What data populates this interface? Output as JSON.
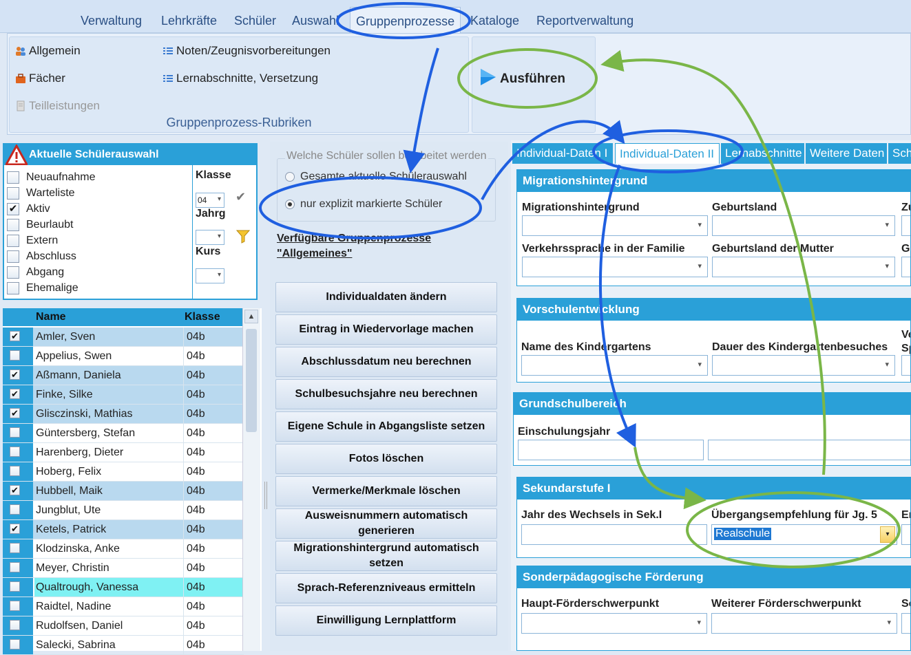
{
  "menu": {
    "items": [
      "Verwaltung",
      "Lehrkräfte",
      "Schüler",
      "Auswahl",
      "Gruppenprozesse",
      "Kataloge",
      "Reportverwaltung"
    ],
    "active_index": 4
  },
  "ribbon": {
    "allgemein": "Allgemein",
    "faecher": "Fächer",
    "teilleistungen": "Teilleistungen",
    "noten": "Noten/Zeugnisvorbereitungen",
    "lernabschnitte": "Lernabschnitte, Versetzung",
    "group_caption": "Gruppenprozess-Rubriken",
    "ausfuehren": "Ausführen"
  },
  "selection": {
    "title": "Aktuelle Schülerauswahl",
    "statuses": [
      {
        "label": "Neuaufnahme",
        "checked": false
      },
      {
        "label": "Warteliste",
        "checked": false
      },
      {
        "label": "Aktiv",
        "checked": true
      },
      {
        "label": "Beurlaubt",
        "checked": false
      },
      {
        "label": "Extern",
        "checked": false
      },
      {
        "label": "Abschluss",
        "checked": false
      },
      {
        "label": "Abgang",
        "checked": false
      },
      {
        "label": "Ehemalige",
        "checked": false
      }
    ],
    "klasse_label": "Klasse",
    "klasse_value": "04",
    "jahrg_label": "Jahrg",
    "kurs_label": "Kurs"
  },
  "students": {
    "col_name": "Name",
    "col_klasse": "Klasse",
    "rows": [
      {
        "name": "Amler, Sven",
        "klasse": "04b",
        "checked": true
      },
      {
        "name": "Appelius, Swen",
        "klasse": "04b",
        "checked": false
      },
      {
        "name": "Aßmann, Daniela",
        "klasse": "04b",
        "checked": true
      },
      {
        "name": "Finke, Silke",
        "klasse": "04b",
        "checked": true
      },
      {
        "name": "Glisczinski, Mathias",
        "klasse": "04b",
        "checked": true
      },
      {
        "name": "Güntersberg, Stefan",
        "klasse": "04b",
        "checked": false
      },
      {
        "name": "Harenberg, Dieter",
        "klasse": "04b",
        "checked": false
      },
      {
        "name": "Hoberg, Felix",
        "klasse": "04b",
        "checked": false
      },
      {
        "name": "Hubbell, Maik",
        "klasse": "04b",
        "checked": true
      },
      {
        "name": "Jungblut, Ute",
        "klasse": "04b",
        "checked": false
      },
      {
        "name": "Ketels, Patrick",
        "klasse": "04b",
        "checked": true
      },
      {
        "name": "Klodzinska, Anke",
        "klasse": "04b",
        "checked": false
      },
      {
        "name": "Meyer, Christin",
        "klasse": "04b",
        "checked": false
      },
      {
        "name": "Qualtrough, Vanessa",
        "klasse": "04b",
        "checked": false,
        "highlight": true
      },
      {
        "name": "Raidtel, Nadine",
        "klasse": "04b",
        "checked": false
      },
      {
        "name": "Rudolfsen, Daniel",
        "klasse": "04b",
        "checked": false
      },
      {
        "name": "Salecki, Sabrina",
        "klasse": "04b",
        "checked": false
      }
    ]
  },
  "middle": {
    "question": "Welche Schüler sollen bearbeitet werden",
    "opt_all": "Gesamte aktuelle Schülerauswahl",
    "opt_marked": "nur explizit markierte Schüler",
    "available_line1": "Verfügbare Gruppenprozesse",
    "available_line2": "\"Allgemeines\"",
    "processes": [
      "Individualdaten ändern",
      "Eintrag in Wiedervorlage machen",
      "Abschlussdatum neu berechnen",
      "Schulbesuchsjahre neu berechnen",
      "Eigene Schule in Abgangsliste setzen",
      "Fotos löschen",
      "Vermerke/Merkmale löschen",
      "Ausweisnummern automatisch generieren",
      "Migrationshintergrund automatisch setzen",
      "Sprach-Referenzniveaus ermitteln",
      "Einwilligung Lernplattform"
    ]
  },
  "tabs": [
    "Individual-Daten I",
    "Individual-Daten II",
    "Lernabschnitte",
    "Weitere Daten",
    "Sch"
  ],
  "sections": {
    "migration": {
      "title": "Migrationshintergrund",
      "f1": "Migrationshintergrund",
      "f2": "Geburtsland",
      "f3": "Zu",
      "f4": "Verkehrssprache in der Familie",
      "f5": "Geburtsland der Mutter",
      "f6": "Ge"
    },
    "vorschule": {
      "title": "Vorschulentwicklung",
      "f1": "Name des Kindergartens",
      "f2": "Dauer des Kindergartenbesuches",
      "f3a": "Ve",
      "f3b": "Sp"
    },
    "grundschule": {
      "title": "Grundschulbereich",
      "f1": "Einschulungsjahr"
    },
    "sek1": {
      "title": "Sekundarstufe I",
      "f1": "Jahr des Wechsels in Sek.I",
      "f2": "Übergangsempfehlung für Jg. 5",
      "f3": "Er",
      "empfehlung_value": "Realschule"
    },
    "sonder": {
      "title": "Sonderpädagogische Förderung",
      "f1": "Haupt-Förderschwerpunkt",
      "f2": "Weiterer Förderschwerpunkt",
      "f3": "So"
    }
  },
  "colors": {
    "accent": "#2aa0d8",
    "annotation_blue": "#1f5fe0",
    "annotation_green": "#7ab648",
    "highlight_row": "#7ff1f3"
  }
}
